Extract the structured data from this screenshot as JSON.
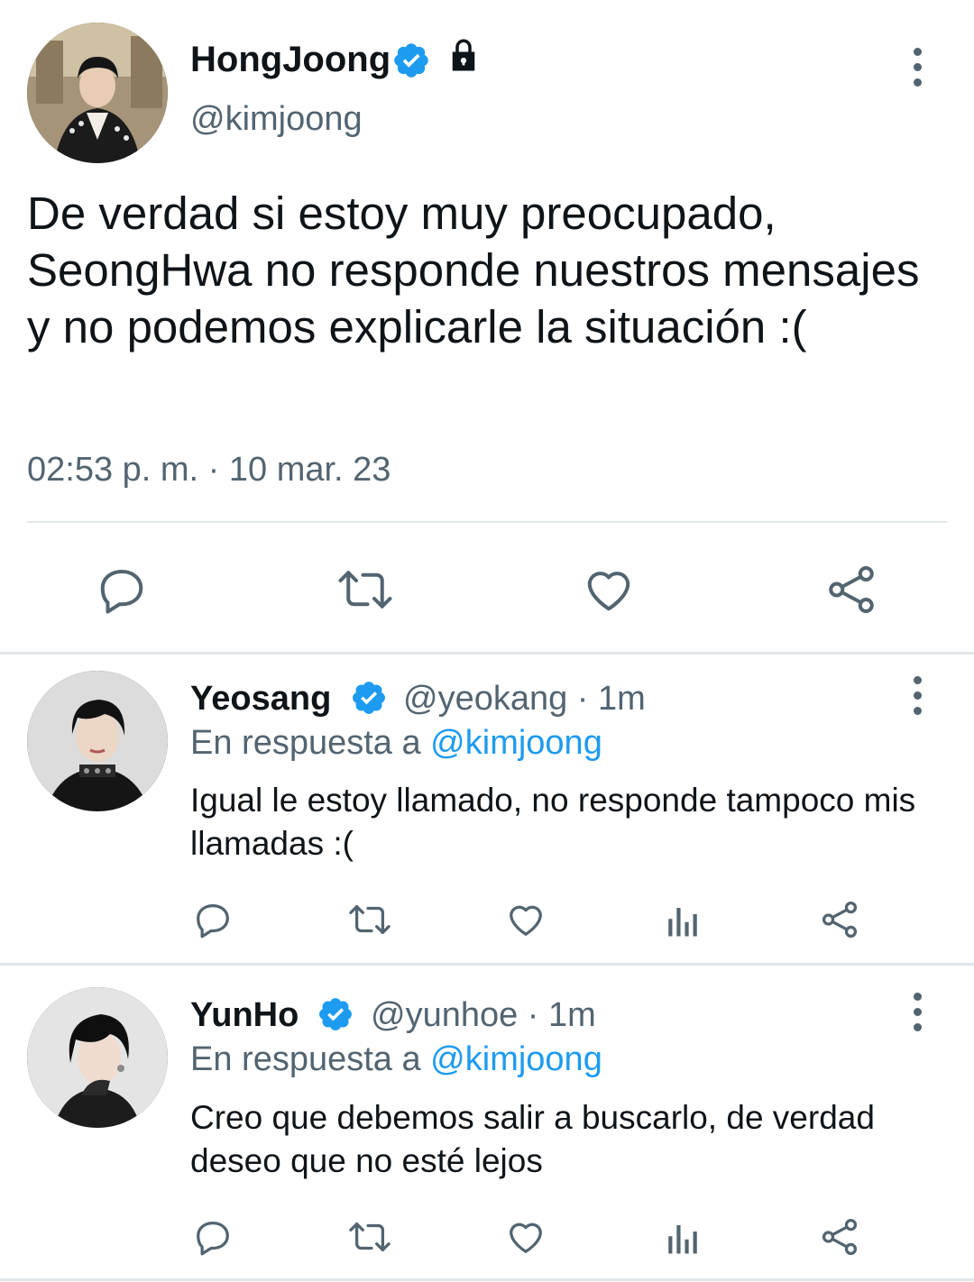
{
  "colors": {
    "accent": "#1d9bf0",
    "secondary_text": "#536471",
    "divider": "#e1e6ea"
  },
  "main_tweet": {
    "author_name": "HongJoong",
    "handle": "@kimjoong",
    "verified_icon": "verified-badge-icon",
    "protected_icon": "lock-icon",
    "text": "De verdad si estoy muy preocupado, SeongHwa no responde nuestros mensajes y no podemos explicarle la situación :(",
    "timestamp": "02:53 p. m. · 10 mar. 23",
    "actions": [
      "reply-icon",
      "retweet-icon",
      "like-icon",
      "share-icon"
    ]
  },
  "replies": [
    {
      "author_name": "Yeosang",
      "handle_time": "@yeokang · 1m",
      "reply_prefix": "En respuesta a ",
      "reply_mention": "@kimjoong",
      "text": "Igual le estoy llamado, no responde tampoco mis llamadas :(",
      "actions": [
        "reply-icon",
        "retweet-icon",
        "like-icon",
        "analytics-icon",
        "share-icon"
      ]
    },
    {
      "author_name": "YunHo",
      "handle_time": "@yunhoe · 1m",
      "reply_prefix": "En respuesta a ",
      "reply_mention": "@kimjoong",
      "text": "Creo que debemos salir a buscarlo, de verdad deseo que no esté lejos",
      "actions": [
        "reply-icon",
        "retweet-icon",
        "like-icon",
        "analytics-icon",
        "share-icon"
      ]
    }
  ]
}
